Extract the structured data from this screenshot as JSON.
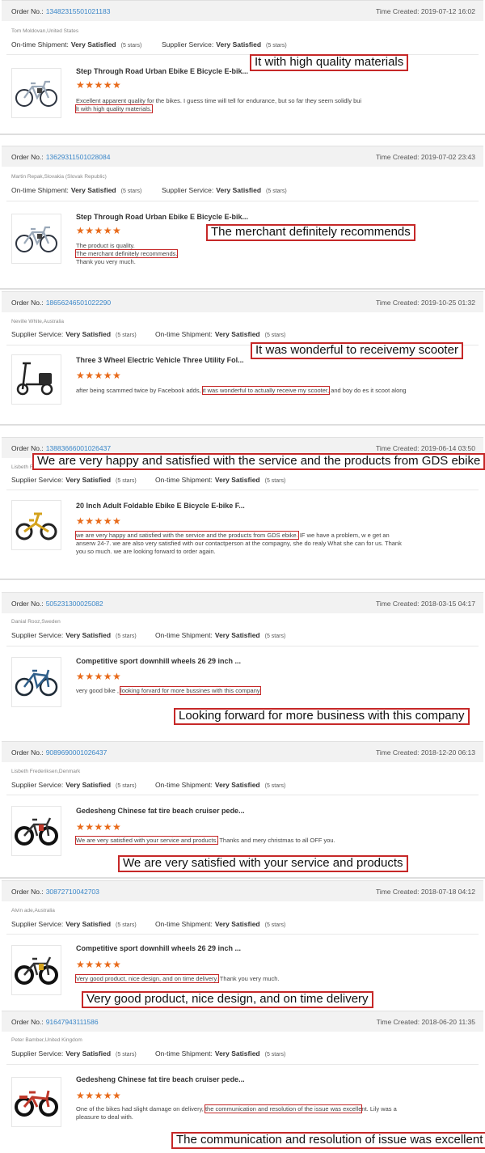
{
  "labels": {
    "order_no": "Order No.:",
    "time_created": "Time Created:",
    "on_time_shipment": "On-time Shipment:",
    "supplier_service": "Supplier Service:",
    "very_satisfied": "Very Satisfied",
    "five_stars": "(5 stars)",
    "stars_glyph": "★★★★★"
  },
  "colors": {
    "accent_link": "#3a86c8",
    "star": "#e86a1a",
    "highlight": "#c62828"
  },
  "reviews": [
    {
      "order_no": "13482315501021183",
      "time": "2019-07-12 16:02",
      "reviewer": "Tom Moldovan,United States",
      "product": "Step Through Road Urban Ebike E Bicycle E-bik...",
      "comment_pre": "Excellent apparent quality for the bikes.  I guess time will tell for endurance, but so far they seem solidly bui",
      "highlight": "lt with high quality materials.",
      "comment_post": "",
      "callout": "It with high quality materials"
    },
    {
      "order_no": "13629311501028084",
      "time": "2019-07-02 23:43",
      "reviewer": "Martin Repak,Slovakia (Slovak Republic)",
      "product": "Step Through Road Urban Ebike E Bicycle E-bik...",
      "comment_pre": "The product is quality.",
      "highlight": "The merchant definitely recommends.",
      "comment_post": "Thank you very much.",
      "callout": "The merchant definitely recommends"
    },
    {
      "order_no": "18656246501022290",
      "time": "2019-10-25 01:32",
      "reviewer": "Neville White,Australia",
      "product": "Three 3 Wheel Electric Vehicle Three Utility Fol...",
      "comment_pre": "after being scammed twice by Facebook adds,",
      "highlight": "it was wonderful to actually receive my scooter,",
      "comment_post": "and boy do es it scoot along",
      "callout": "It was wonderful to receivemy scooter"
    },
    {
      "order_no": "13883666001026437",
      "time": "2019-06-14 03:50",
      "reviewer": "Lisbeth Frederiksen,Denmark",
      "product": "20 Inch Adult Foldable Ebike E Bicycle E-bike F...",
      "comment_pre": "",
      "highlight": "we are very happy and satisfied with the service and the products from GDS ebike.",
      "comment_post": "IF we have a problem, w e get an anserw 24-7. we are also very satisfied with our contactperson at the compagny, she do realy What she can for us. Thank you so much. we are looking forward to order again.",
      "callout": "We are very happy and satisfied with the service and the products from GDS ebike"
    },
    {
      "order_no": "505231300025082",
      "time": "2018-03-15 04:17",
      "reviewer": "Danial Rooz,Sweden",
      "product": "Competitive sport downhill wheels 26 29 inch ...",
      "comment_pre": "very good bike ,",
      "highlight": "looking forvard for more bussines with this company",
      "comment_post": "",
      "callout": "Looking forward for more business with this company"
    },
    {
      "order_no": "9089690001026437",
      "time": "2018-12-20 06:13",
      "reviewer": "Lisbeth Frederiksen,Denmark",
      "product": "Gedesheng Chinese fat tire beach cruiser pede...",
      "comment_pre": "",
      "highlight": "We are very satisfied with your service and products.",
      "comment_post": "Thanks and mery christmas to all OFF you.",
      "callout": "We are very satisfied with your service and products"
    },
    {
      "order_no": "30872710042703",
      "time": "2018-07-18 04:12",
      "reviewer": "Alvin ade,Australia",
      "product": "Competitive sport downhill wheels 26 29 inch ...",
      "comment_pre": "",
      "highlight": "Very good product, nice design, and on time delivery.",
      "comment_post": "Thank you very much.",
      "callout": "Very good product, nice design, and on time delivery"
    },
    {
      "order_no": "91647943111586",
      "time": "2018-06-20 11:35",
      "reviewer": "Peter Bamber,United Kingdom",
      "product": "Gedesheng Chinese fat tire beach cruiser pede...",
      "comment_pre": "One of the bikes had slight damage on delivery,",
      "highlight": "the communication and resolution of the issue was excelle",
      "comment_post": "nt. Lily was a pleasure to deal with.",
      "callout": "The communication and resolution of issue was excellent"
    }
  ]
}
